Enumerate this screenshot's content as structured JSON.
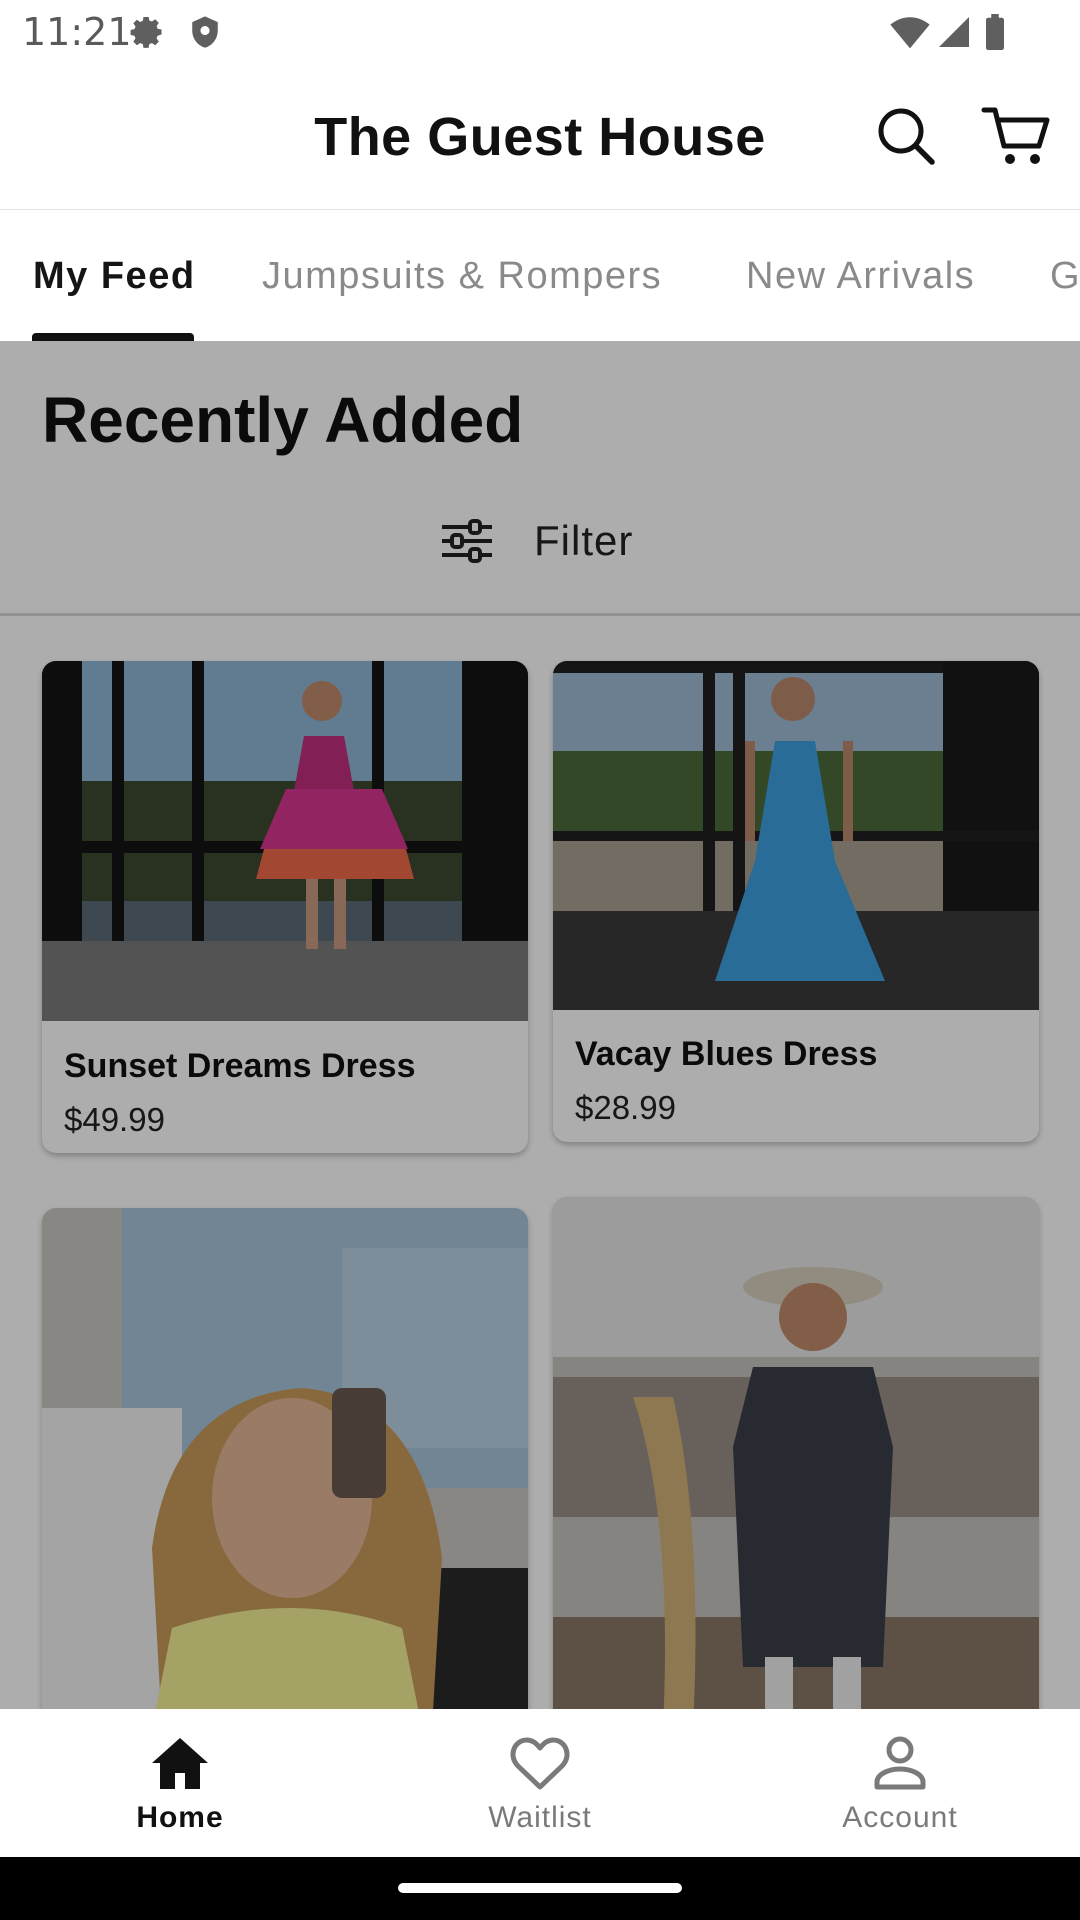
{
  "status_bar": {
    "time": "11:21",
    "icons": [
      "settings-gear-icon",
      "shield-icon",
      "wifi-icon",
      "signal-icon",
      "battery-icon"
    ]
  },
  "header": {
    "title": "The Guest House",
    "actions": [
      "search-icon",
      "cart-icon"
    ]
  },
  "tabs": [
    {
      "label": "My Feed",
      "active": true
    },
    {
      "label": "Jumpsuits & Rompers",
      "active": false
    },
    {
      "label": "New Arrivals",
      "active": false
    },
    {
      "label": "G",
      "active": false
    }
  ],
  "section": {
    "title": "Recently Added",
    "filter_label": "Filter"
  },
  "products": [
    {
      "name": "Sunset Dreams Dress",
      "price": "$49.99",
      "accent": "#d8358f"
    },
    {
      "name": "Vacay Blues Dress",
      "price": "$28.99",
      "accent": "#3d9fe0"
    },
    {
      "name": "",
      "price": "",
      "accent": "#f3ef97"
    },
    {
      "name": "",
      "price": "",
      "accent": "#3b3f4a"
    }
  ],
  "bottom_nav": [
    {
      "label": "Home",
      "icon": "home-icon",
      "active": true
    },
    {
      "label": "Waitlist",
      "icon": "heart-icon",
      "active": false
    },
    {
      "label": "Account",
      "icon": "person-icon",
      "active": false
    }
  ],
  "colors": {
    "overlay": "rgba(0,0,0,0.32)",
    "text": "#111111",
    "inactive": "#8a8a8a"
  }
}
